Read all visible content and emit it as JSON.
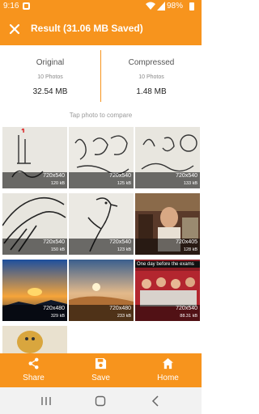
{
  "status_bar": {
    "time": "9:16",
    "battery": "98%",
    "icons": [
      "notification-icon",
      "wifi-icon",
      "signal-icon",
      "battery-icon"
    ]
  },
  "toolbar": {
    "title": "Result (31.06 MB Saved)",
    "close_icon": "close-icon"
  },
  "summary": {
    "original": {
      "label": "Original",
      "photos": "10 Photos",
      "size": "32.54 MB"
    },
    "compressed": {
      "label": "Compressed",
      "photos": "10 Photos",
      "size": "1.48 MB"
    }
  },
  "hint": "Tap photo to compare",
  "photos": [
    {
      "dim": "720x540",
      "kb": "120 kB"
    },
    {
      "dim": "720x540",
      "kb": "125 kB"
    },
    {
      "dim": "720x540",
      "kb": "133 kB"
    },
    {
      "dim": "720x540",
      "kb": "150 kB"
    },
    {
      "dim": "720x540",
      "kb": "123 kB"
    },
    {
      "dim": "720x405",
      "kb": "128 kB"
    },
    {
      "dim": "720x480",
      "kb": "329 kB"
    },
    {
      "dim": "720x480",
      "kb": "233 kB"
    },
    {
      "dim": "720x540",
      "kb": "88.31 kB",
      "banner": "One day before the exams"
    },
    {
      "dim": "",
      "kb": ""
    }
  ],
  "actions": [
    {
      "label": "Share",
      "icon": "share-icon"
    },
    {
      "label": "Save",
      "icon": "save-icon"
    },
    {
      "label": "Home",
      "icon": "home-icon"
    }
  ],
  "nav": [
    "recent-apps-icon",
    "home-nav-icon",
    "back-icon"
  ],
  "colors": {
    "accent": "#f7941d"
  }
}
